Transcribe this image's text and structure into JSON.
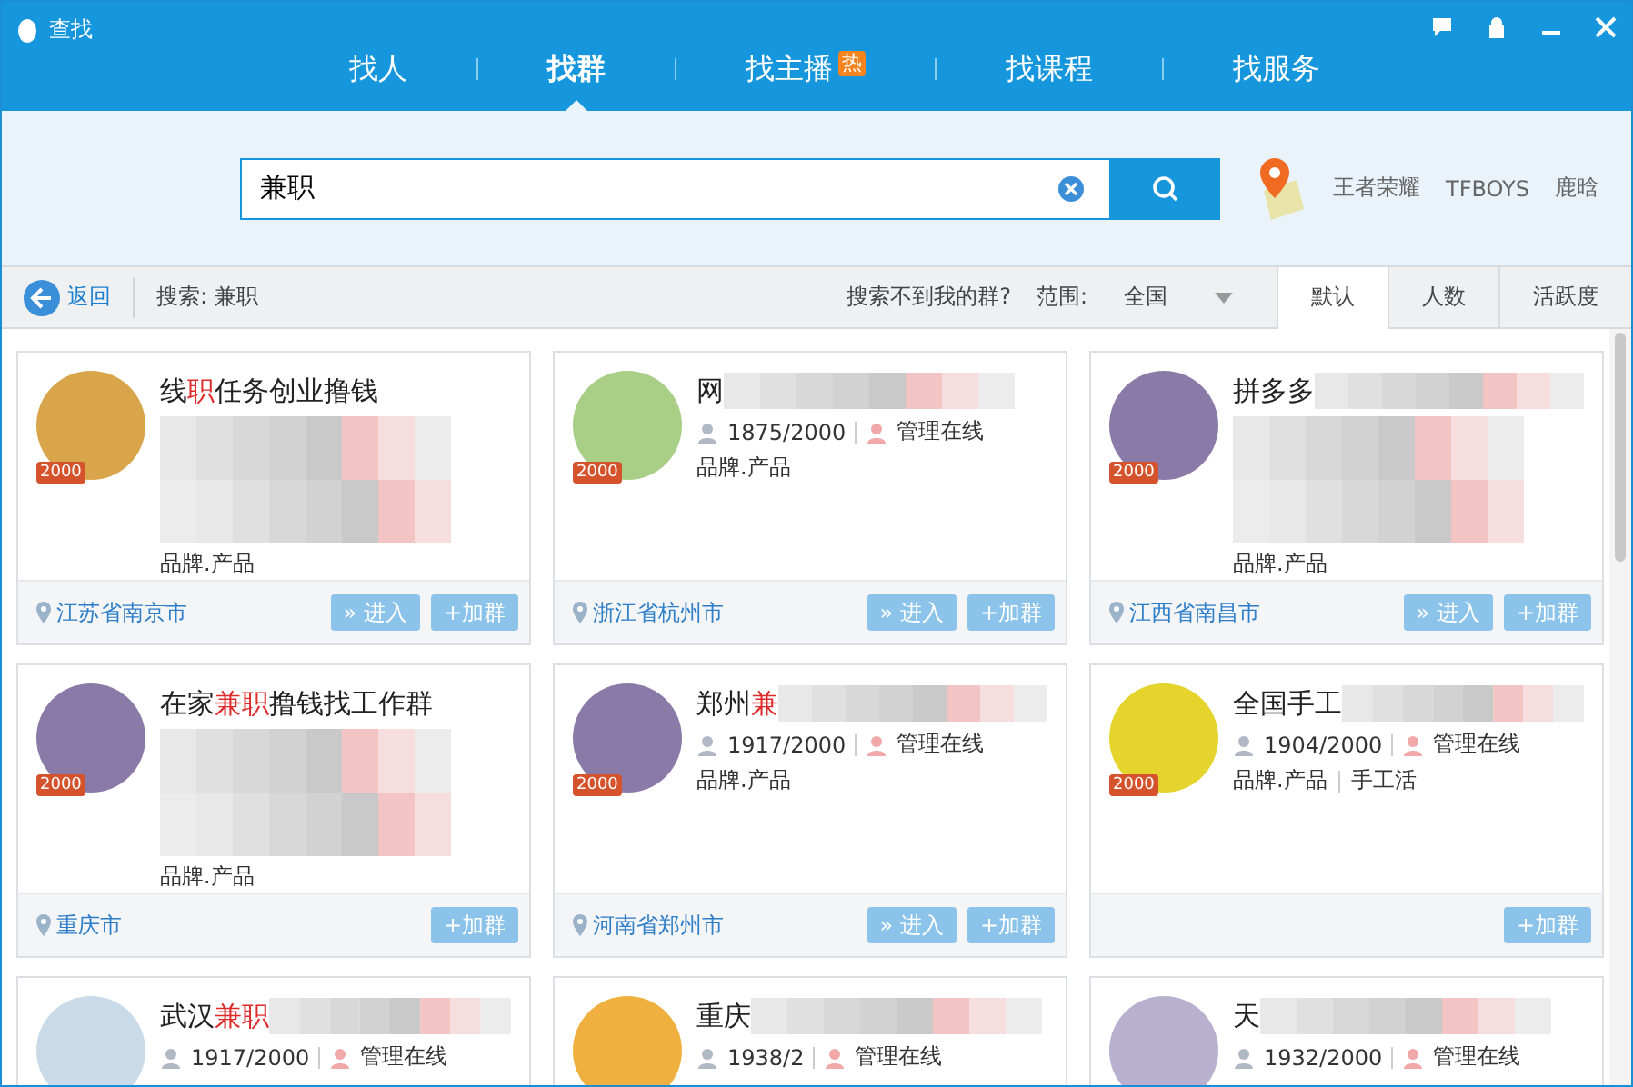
{
  "window": {
    "title": "查找"
  },
  "tabs": [
    {
      "label": "找人",
      "selected": false
    },
    {
      "label": "找群",
      "selected": true
    },
    {
      "label": "找主播",
      "selected": false,
      "badge": "热"
    },
    {
      "label": "找课程",
      "selected": false
    },
    {
      "label": "找服务",
      "selected": false
    }
  ],
  "search": {
    "value": "兼职",
    "hot_keywords": [
      "王者荣耀",
      "TFBOYS",
      "鹿晗"
    ]
  },
  "toolbar": {
    "back": "返回",
    "query": "搜索: 兼职",
    "help": "搜索不到我的群?",
    "scope_label": "范围:",
    "scope": "全国",
    "sort_tabs": [
      {
        "label": "默认",
        "selected": true
      },
      {
        "label": "人数",
        "selected": false
      },
      {
        "label": "活跃度",
        "selected": false
      }
    ]
  },
  "cards": [
    {
      "title": [
        {
          "text": "线",
          "highlight": false
        },
        {
          "text": "职",
          "highlight": true
        },
        {
          "text": "任务创业撸钱",
          "highlight": false
        }
      ],
      "title_mosaic": false,
      "body_mosaic": true,
      "badge": "2000",
      "tags": [
        "品牌.产品"
      ],
      "location": "江苏省南京市",
      "enter": "» 进入",
      "join": "+加群"
    },
    {
      "title": [
        {
          "text": "网",
          "highlight": false
        }
      ],
      "title_mosaic": true,
      "body_mosaic": false,
      "stats": {
        "members": "1875/2000",
        "admin": "管理在线"
      },
      "badge": "2000",
      "tags": [
        "品牌.产品"
      ],
      "location": "浙江省杭州市",
      "enter": "» 进入",
      "join": "+加群"
    },
    {
      "title": [
        {
          "text": "拼多多",
          "highlight": false
        }
      ],
      "title_mosaic": true,
      "body_mosaic": true,
      "badge": "2000",
      "tags": [
        "品牌.产品"
      ],
      "location": "江西省南昌市",
      "enter": "» 进入",
      "join": "+加群"
    },
    {
      "title": [
        {
          "text": "在家",
          "highlight": false
        },
        {
          "text": "兼职",
          "highlight": true
        },
        {
          "text": "撸钱找工作群",
          "highlight": false
        }
      ],
      "title_mosaic": false,
      "body_mosaic": true,
      "badge": "2000",
      "tags": [
        "品牌.产品"
      ],
      "location": "重庆市",
      "join": "+加群"
    },
    {
      "title": [
        {
          "text": "郑州",
          "highlight": false
        },
        {
          "text": "兼",
          "highlight": true
        }
      ],
      "title_mosaic": true,
      "body_mosaic": false,
      "stats": {
        "members": "1917/2000",
        "admin": "管理在线"
      },
      "badge": "2000",
      "tags": [
        "品牌.产品"
      ],
      "location": "河南省郑州市",
      "enter": "» 进入",
      "join": "+加群"
    },
    {
      "title": [
        {
          "text": "全国手工",
          "highlight": false
        }
      ],
      "title_mosaic": true,
      "body_mosaic": false,
      "stats": {
        "members": "1904/2000",
        "admin": "管理在线"
      },
      "badge": "2000",
      "tags": [
        "品牌.产品",
        "手工活"
      ],
      "join": "+加群"
    },
    {
      "title": [
        {
          "text": "武汉",
          "highlight": false
        },
        {
          "text": "兼职",
          "highlight": true
        }
      ],
      "title_mosaic": true,
      "body_mosaic": false,
      "stats": {
        "members": "1917/2000",
        "admin": "管理在线"
      }
    },
    {
      "title": [
        {
          "text": "重庆",
          "highlight": false
        }
      ],
      "title_mosaic": true,
      "body_mosaic": false,
      "stats": {
        "members": "1938/2",
        "admin": "管理在线"
      }
    },
    {
      "title": [
        {
          "text": "天",
          "highlight": false
        }
      ],
      "title_mosaic": true,
      "body_mosaic": false,
      "stats": {
        "members": "1932/2000",
        "admin": "管理在线"
      }
    }
  ]
}
